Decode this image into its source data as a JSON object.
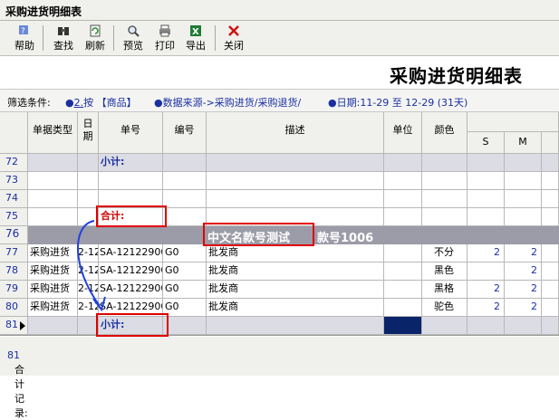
{
  "window": {
    "title": "采购进货明细表"
  },
  "toolbar": {
    "help": "帮助",
    "search": "查找",
    "refresh": "刷新",
    "preview": "预览",
    "print": "打印",
    "export": "导出",
    "close": "关闭"
  },
  "report": {
    "title": "采购进货明细表"
  },
  "filter": {
    "label": "筛选条件:",
    "item1_num": "2.",
    "item1": "按 【商品】",
    "item2": "数据来源->采购进货/采购退货/",
    "item3": "日期:11-29 至 12-29 (31天)"
  },
  "columns": {
    "type": "单据类型",
    "date": "日\n期",
    "bill": "单号",
    "code": "编号",
    "desc": "描述",
    "unit": "单位",
    "color": "颜色",
    "s": "S",
    "m": "M"
  },
  "rows": {
    "r72": {
      "num": "72",
      "label": "小计:"
    },
    "r73": {
      "num": "73"
    },
    "r74": {
      "num": "74"
    },
    "r75": {
      "num": "75",
      "label": "合计:"
    },
    "r76": {
      "num": "76",
      "group_name": "中文名款号测试",
      "group_code": "款号1006"
    },
    "r77": {
      "num": "77",
      "type": "采购进货",
      "date": "2-12",
      "bill": "SA-12122900",
      "code": "G0",
      "desc": "批发商",
      "color": "不分",
      "s": "2",
      "m": "2"
    },
    "r78": {
      "num": "78",
      "type": "采购进货",
      "date": "2-12",
      "bill": "SA-12122900",
      "code": "G0",
      "desc": "批发商",
      "color": "黑色",
      "s": "",
      "m": "2"
    },
    "r79": {
      "num": "79",
      "type": "采购进货",
      "date": "2-12",
      "bill": "SA-12122900",
      "code": "G0",
      "desc": "批发商",
      "color": "黑格",
      "s": "2",
      "m": "2"
    },
    "r80": {
      "num": "80",
      "type": "采购进货",
      "date": "2-12",
      "bill": "SA-12122900",
      "code": "G0",
      "desc": "批发商",
      "color": "驼色",
      "s": "2",
      "m": "2"
    },
    "r81": {
      "num": "81",
      "label": "小计:"
    }
  },
  "status": {
    "label": "合计记录:",
    "count": "81"
  },
  "colors": {
    "accent_blue": "#1a2fa0",
    "total_red": "#cc0000",
    "group_bar": "#9c9ca8",
    "selection": "#0a246a"
  }
}
